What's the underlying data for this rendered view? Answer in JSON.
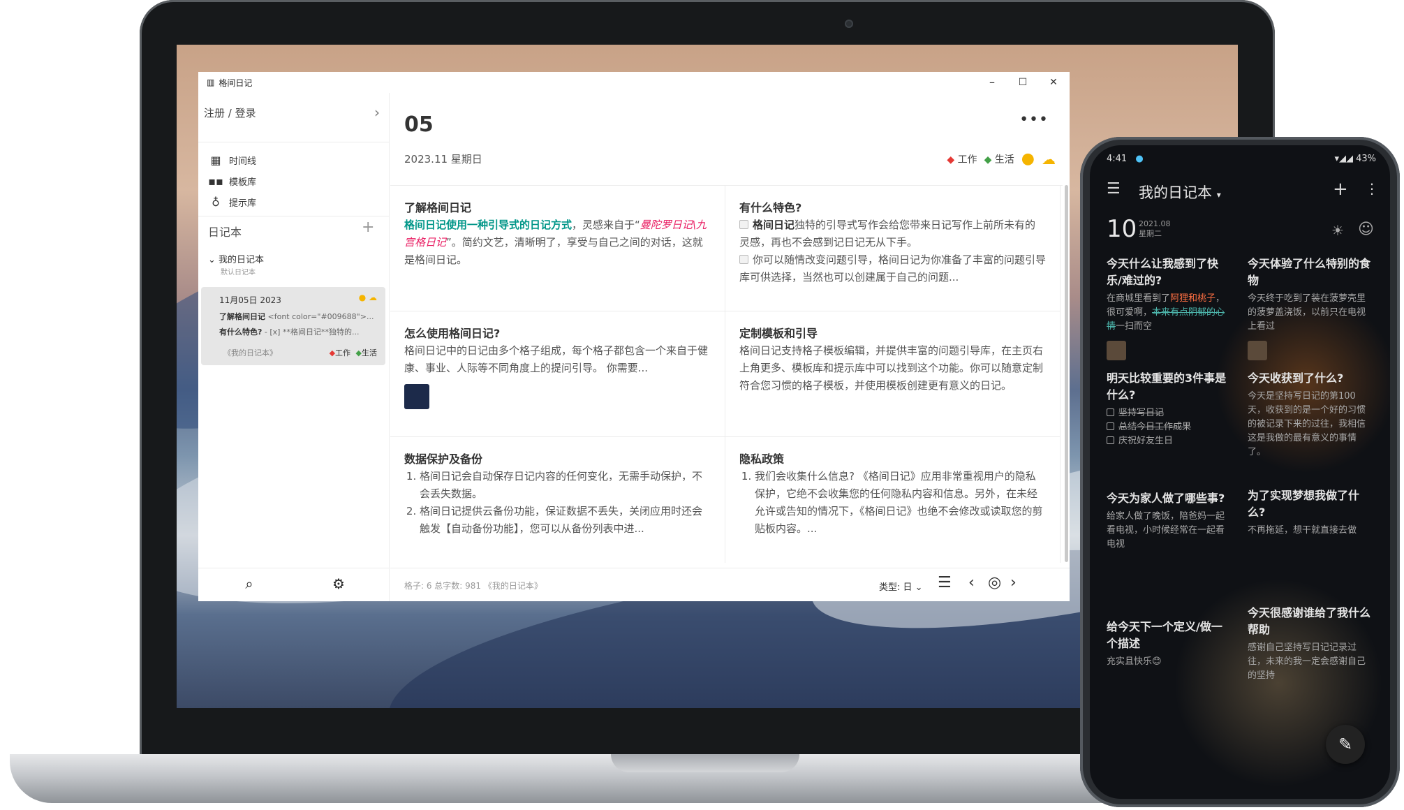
{
  "window": {
    "app_title": "格间日记",
    "minimize": "–",
    "maximize": "☐",
    "close": "✕"
  },
  "sidebar": {
    "login": "注册 / 登录",
    "nav": [
      {
        "label": "时间线",
        "icon": "calendar-icon"
      },
      {
        "label": "模板库",
        "icon": "grid-icon"
      },
      {
        "label": "提示库",
        "icon": "bulb-icon"
      }
    ],
    "section_title": "日记本",
    "notebook": {
      "name": "我的日记本",
      "sub": "默认日记本"
    },
    "entry_card": {
      "date": "11月05日 2023",
      "line1_title": "了解格间日记",
      "line1_rest": "<font color=\"#009688\">...",
      "line2_title": "有什么特色?",
      "line2_rest": "- [x] **格间日记**独特的...",
      "notebook": "《我的日记本》",
      "tag_work": "工作",
      "tag_life": "生活"
    }
  },
  "main": {
    "day": "05",
    "date": "2023.11 星期日",
    "tags": [
      "工作",
      "生活"
    ],
    "cells": {
      "c1": {
        "title": "了解格间日记",
        "hl": "格间日记使用一种引导式的日记方式",
        "t1": "，灵感来自于“",
        "pink": "曼陀罗日记\\九宫格日记",
        "t2": "”。简约文艺，清晰明了，享受与自己之间的对话，这就是格间日记。"
      },
      "c2": {
        "title": "有什么特色?",
        "b1_bold": "格间日记",
        "b1_rest": "独特的引导式写作会给您带来日记写作上前所未有的灵感，再也不会感到记日记无从下手。",
        "b2": "你可以随情改变问题引导，格间日记为你准备了丰富的问题引导库可供选择，当然也可以创建属于自己的问题..."
      },
      "c3": {
        "title": "怎么使用格间日记?",
        "body": "格间日记中的日记由多个格子组成，每个格子都包含一个来自于健康、事业、人际等不同角度上的提问引导。 你需要..."
      },
      "c4": {
        "title": "定制模板和引导",
        "body": "格间日记支持格子模板编辑，并提供丰富的问题引导库，在主页右上角更多、模板库和提示库中可以找到这个功能。你可以随意定制符合您习惯的格子模板，并使用模板创建更有意义的日记。"
      },
      "c5": {
        "title": "数据保护及备份",
        "li1": "格间日记会自动保存日记内容的任何变化，无需手动保护，不会丢失数据。",
        "li2": "格间日记提供云备份功能，保证数据不丢失，关闭应用时还会触发【自动备份功能】，您可以从备份列表中进..."
      },
      "c6": {
        "title": "隐私政策",
        "li1": "我们会收集什么信息? 《格间日记》应用非常重视用户的隐私保护，它绝不会收集您的任何隐私内容和信息。另外，在未经允许或告知的情况下，《格间日记》也绝不会修改或读取您的剪贴板内容。..."
      }
    },
    "footer": {
      "stats": "格子: 6    总字数: 981    《我的日记本》",
      "type": "类型: 日"
    }
  },
  "phone": {
    "time": "4:41",
    "battery": "43%",
    "title": "我的日记本",
    "day": "10",
    "day_sub1": "2021.08",
    "day_sub2": "星期二",
    "left": {
      "q1": "今天什么让我感到了快乐/难过的?",
      "a1_1": "在商城里看到了",
      "a1_red": "阿狸和桃子",
      "a1_2": "，很可爱啊，",
      "a1_grn": "本来有点阴郁的心情",
      "a1_3": "一扫而空",
      "q2": "明天比较重要的3件事是什么?",
      "c1": "坚持写日记",
      "c2": "总结今日工作成果",
      "c3": "庆祝好友生日",
      "q3": "今天为家人做了哪些事?",
      "a3": "给家人做了晚饭，陪爸妈一起看电视，小时候经常在一起看电视",
      "q4": "给今天下一个定义/做一个描述",
      "a4": "充实且快乐😊"
    },
    "right": {
      "q1": "今天体验了什么特别的食物",
      "a1": "今天终于吃到了装在菠萝壳里的菠萝盖浇饭，以前只在电视上看过",
      "q2": "今天收获到了什么?",
      "a2": "今天是坚持写日记的第100天，收获到的是一个好的习惯的被记录下来的过往，我相信这是我做的最有意义的事情了。",
      "q3": "为了实现梦想我做了什么?",
      "a3": "不再拖延，想干就直接去做",
      "q4": "今天很感谢谁给了我什么帮助",
      "a4": "感谢自己坚持写日记记录过往，未来的我一定会感谢自己的坚持"
    }
  }
}
